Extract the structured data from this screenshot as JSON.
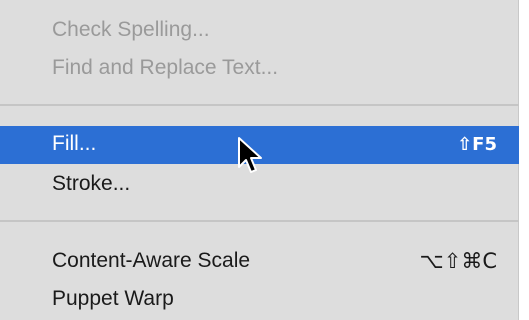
{
  "menu": {
    "groups": [
      {
        "items": [
          {
            "label": "Check Spelling...",
            "shortcut": "",
            "state": "disabled"
          },
          {
            "label": "Find and Replace Text...",
            "shortcut": "",
            "state": "disabled"
          }
        ]
      },
      {
        "items": [
          {
            "label": "Fill...",
            "shortcut": "⇧F5",
            "state": "highlighted"
          },
          {
            "label": "Stroke...",
            "shortcut": "",
            "state": "enabled"
          }
        ]
      },
      {
        "items": [
          {
            "label": "Content-Aware Scale",
            "shortcut": "⌥⇧⌘C",
            "state": "enabled"
          },
          {
            "label": "Puppet Warp",
            "shortcut": "",
            "state": "enabled"
          }
        ]
      }
    ]
  },
  "cursor": {
    "icon": "arrow-pointer-icon"
  },
  "colors": {
    "menu_background": "#dddddd",
    "highlight": "#2c6fd4",
    "disabled_text": "#9a9a9a",
    "separator": "#c5c5c5"
  }
}
